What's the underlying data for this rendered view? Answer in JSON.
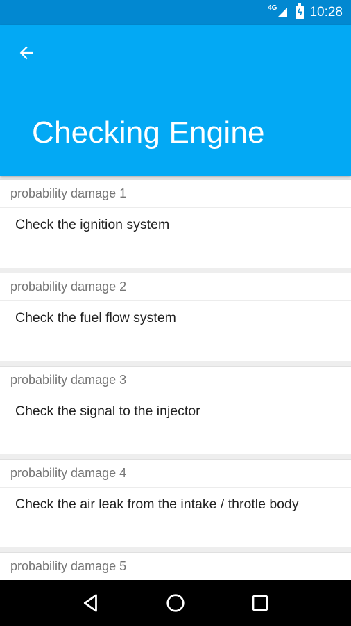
{
  "status_bar": {
    "network": "4G",
    "time": "10:28"
  },
  "app_bar": {
    "title": "Checking Engine",
    "back_icon": "arrow-left-icon",
    "color": "#03a9f4",
    "status_color": "#0288d1"
  },
  "cards": [
    {
      "header": "probability damage 1",
      "body": "Check the ignition system"
    },
    {
      "header": "probability damage 2",
      "body": "Check the fuel flow system"
    },
    {
      "header": "probability damage 3",
      "body": "Check the signal to the injector"
    },
    {
      "header": "probability damage 4",
      "body": "Check the air leak from the intake / throtle body"
    },
    {
      "header": "probability damage 5",
      "body": ""
    }
  ],
  "nav_bar": {
    "back_icon": "triangle-back-icon",
    "home_icon": "circle-home-icon",
    "recents_icon": "square-recents-icon"
  }
}
